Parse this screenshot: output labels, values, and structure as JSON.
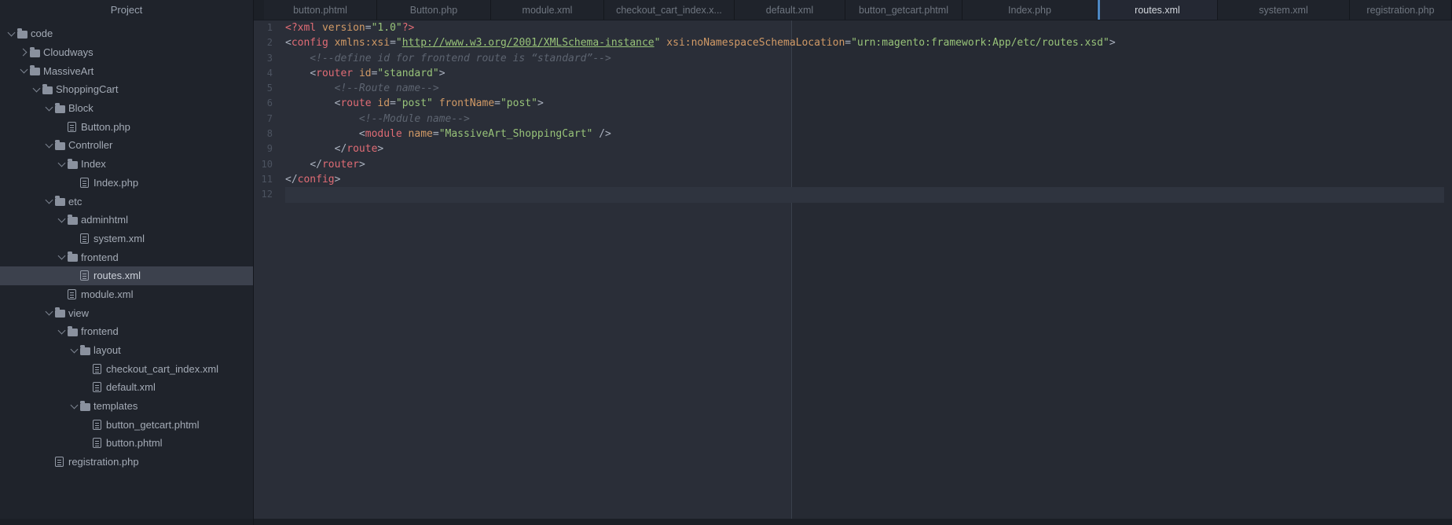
{
  "colors": {
    "panel-bg": "#1f232b",
    "panel-selected": "#3c414d",
    "tree-text": "#a4abb6",
    "tabbar-bg": "#1c2027",
    "tab-bg": "#1f232b",
    "tab-active-bg": "#242833",
    "tab-text": "#6f7680",
    "tab-active-text": "#d3d7dd",
    "tab-accent": "#4d87c2",
    "editor-bg": "#2a2e38",
    "editor-bg-right": "#262a33",
    "guide": "#3a404c",
    "caret-line": "#2f343f",
    "gutter-text": "#4c5360",
    "syn-tag": "#e06c75",
    "syn-attr": "#d19a66",
    "syn-string": "#98c379",
    "syn-punct": "#abb2bf",
    "syn-comment": "#5d6470",
    "status-bg": "#1b1f26"
  },
  "project_panel": {
    "title": "Project",
    "tree": [
      {
        "label": "code",
        "level": 0,
        "kind": "folder",
        "state": "expanded"
      },
      {
        "label": "Cloudways",
        "level": 1,
        "kind": "folder",
        "state": "collapsed"
      },
      {
        "label": "MassiveArt",
        "level": 1,
        "kind": "folder",
        "state": "expanded"
      },
      {
        "label": "ShoppingCart",
        "level": 2,
        "kind": "folder",
        "state": "expanded"
      },
      {
        "label": "Block",
        "level": 3,
        "kind": "folder",
        "state": "expanded"
      },
      {
        "label": "Button.php",
        "level": 4,
        "kind": "file"
      },
      {
        "label": "Controller",
        "level": 3,
        "kind": "folder",
        "state": "expanded"
      },
      {
        "label": "Index",
        "level": 4,
        "kind": "folder",
        "state": "expanded"
      },
      {
        "label": "Index.php",
        "level": 5,
        "kind": "file"
      },
      {
        "label": "etc",
        "level": 3,
        "kind": "folder",
        "state": "expanded"
      },
      {
        "label": "adminhtml",
        "level": 4,
        "kind": "folder",
        "state": "expanded"
      },
      {
        "label": "system.xml",
        "level": 5,
        "kind": "file"
      },
      {
        "label": "frontend",
        "level": 4,
        "kind": "folder",
        "state": "expanded"
      },
      {
        "label": "routes.xml",
        "level": 5,
        "kind": "file",
        "selected": true
      },
      {
        "label": "module.xml",
        "level": 4,
        "kind": "file"
      },
      {
        "label": "view",
        "level": 3,
        "kind": "folder",
        "state": "expanded"
      },
      {
        "label": "frontend",
        "level": 4,
        "kind": "folder",
        "state": "expanded"
      },
      {
        "label": "layout",
        "level": 5,
        "kind": "folder",
        "state": "expanded"
      },
      {
        "label": "checkout_cart_index.xml",
        "level": 6,
        "kind": "file"
      },
      {
        "label": "default.xml",
        "level": 6,
        "kind": "file"
      },
      {
        "label": "templates",
        "level": 5,
        "kind": "folder",
        "state": "expanded"
      },
      {
        "label": "button_getcart.phtml",
        "level": 6,
        "kind": "file"
      },
      {
        "label": "button.phtml",
        "level": 6,
        "kind": "file"
      },
      {
        "label": "registration.php",
        "level": 3,
        "kind": "file"
      }
    ]
  },
  "tabs": [
    {
      "label": "button.phtml"
    },
    {
      "label": "Button.php"
    },
    {
      "label": "module.xml"
    },
    {
      "label": "checkout_cart_index.x..."
    },
    {
      "label": "default.xml"
    },
    {
      "label": "button_getcart.phtml"
    },
    {
      "label": "Index.php"
    },
    {
      "label": "routes.xml",
      "active": true
    },
    {
      "label": "system.xml"
    },
    {
      "label": "registration.php"
    }
  ],
  "editor": {
    "caret_line": 12,
    "lines": [
      {
        "n": "1",
        "tokens": [
          [
            "tg",
            "<?xml"
          ],
          [
            "pl",
            " "
          ],
          [
            "at",
            "version"
          ],
          [
            "pc",
            "="
          ],
          [
            "st",
            "\"1.0\""
          ],
          [
            "tg",
            "?>"
          ]
        ]
      },
      {
        "n": "2",
        "tokens": [
          [
            "pc",
            "<"
          ],
          [
            "tg",
            "config"
          ],
          [
            "pl",
            " "
          ],
          [
            "at",
            "xmlns:xsi"
          ],
          [
            "pc",
            "="
          ],
          [
            "st",
            "\""
          ],
          [
            "lk",
            "http://www.w3.org/2001/XMLSchema-instance"
          ],
          [
            "st",
            "\""
          ],
          [
            "pl",
            " "
          ],
          [
            "at",
            "xsi:noNamespaceSchemaLocation"
          ],
          [
            "pc",
            "="
          ],
          [
            "st",
            "\"urn:magento:framework:App/etc/routes.xsd\""
          ],
          [
            "pc",
            ">"
          ]
        ]
      },
      {
        "n": "3",
        "tokens": [
          [
            "cm",
            "    <!--define id for frontend route is “standard”-->"
          ]
        ]
      },
      {
        "n": "4",
        "tokens": [
          [
            "pl",
            "    "
          ],
          [
            "pc",
            "<"
          ],
          [
            "tg",
            "router"
          ],
          [
            "pl",
            " "
          ],
          [
            "at",
            "id"
          ],
          [
            "pc",
            "="
          ],
          [
            "st",
            "\"standard\""
          ],
          [
            "pc",
            ">"
          ]
        ]
      },
      {
        "n": "5",
        "tokens": [
          [
            "cm",
            "        <!--Route name-->"
          ]
        ]
      },
      {
        "n": "6",
        "tokens": [
          [
            "pl",
            "        "
          ],
          [
            "pc",
            "<"
          ],
          [
            "tg",
            "route"
          ],
          [
            "pl",
            " "
          ],
          [
            "at",
            "id"
          ],
          [
            "pc",
            "="
          ],
          [
            "st",
            "\"post\""
          ],
          [
            "pl",
            " "
          ],
          [
            "at",
            "frontName"
          ],
          [
            "pc",
            "="
          ],
          [
            "st",
            "\"post\""
          ],
          [
            "pc",
            ">"
          ]
        ]
      },
      {
        "n": "7",
        "tokens": [
          [
            "cm",
            "            <!--Module name-->"
          ]
        ]
      },
      {
        "n": "8",
        "tokens": [
          [
            "pl",
            "            "
          ],
          [
            "pc",
            "<"
          ],
          [
            "tg",
            "module"
          ],
          [
            "pl",
            " "
          ],
          [
            "at",
            "name"
          ],
          [
            "pc",
            "="
          ],
          [
            "st",
            "\"MassiveArt_ShoppingCart\""
          ],
          [
            "pl",
            " "
          ],
          [
            "pc",
            "/>"
          ]
        ]
      },
      {
        "n": "9",
        "tokens": [
          [
            "pl",
            "        "
          ],
          [
            "pc",
            "</"
          ],
          [
            "tg",
            "route"
          ],
          [
            "pc",
            ">"
          ]
        ]
      },
      {
        "n": "10",
        "tokens": [
          [
            "pl",
            "    "
          ],
          [
            "pc",
            "</"
          ],
          [
            "tg",
            "router"
          ],
          [
            "pc",
            ">"
          ]
        ]
      },
      {
        "n": "11",
        "tokens": [
          [
            "pc",
            "</"
          ],
          [
            "tg",
            "config"
          ],
          [
            "pc",
            ">"
          ]
        ]
      },
      {
        "n": "12",
        "tokens": []
      }
    ]
  }
}
